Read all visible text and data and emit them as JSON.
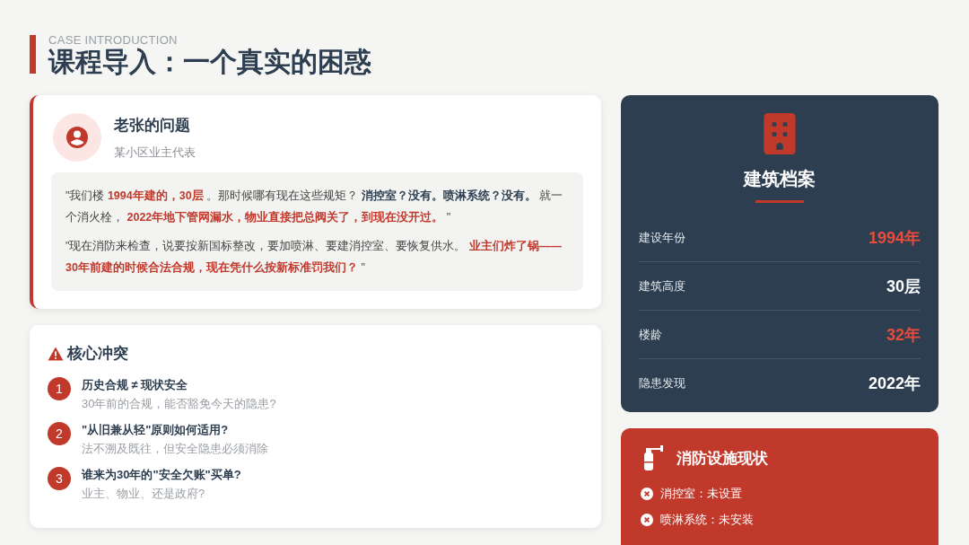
{
  "header": {
    "eyebrow": "CASE INTRODUCTION",
    "title": "课程导入：一个真实的困惑"
  },
  "case": {
    "name": "老张的问题",
    "role": "某小区业主代表",
    "quotes": [
      [
        {
          "text": "\"我们楼 ",
          "kind": "plain"
        },
        {
          "text": "1994年建的，30层",
          "kind": "red"
        },
        {
          "text": " 。那时候哪有现在这些规矩？ ",
          "kind": "plain"
        },
        {
          "text": "消控室？没有。喷淋系统？没有。",
          "kind": "strong"
        },
        {
          "text": " 就一个消火栓， ",
          "kind": "plain"
        },
        {
          "text": "2022年地下管网漏水，物业直接把总阀关了，到现在没开过。",
          "kind": "red"
        },
        {
          "text": " \"",
          "kind": "plain"
        }
      ],
      [
        {
          "text": "\"现在消防来检查，说要按新国标整改，要加喷淋、要建消控室、要恢复供水。 ",
          "kind": "plain"
        },
        {
          "text": "业主们炸了锅——30年前建的时候合法合规，现在凭什么按新标准罚我们？",
          "kind": "red"
        },
        {
          "text": " \"",
          "kind": "plain"
        }
      ]
    ]
  },
  "conflict": {
    "title": "核心冲突",
    "items": [
      {
        "number": "1",
        "title": "历史合规 ≠ 现状安全",
        "desc": "30年前的合规，能否豁免今天的隐患?"
      },
      {
        "number": "2",
        "title": "\"从旧兼从轻\"原则如何适用?",
        "desc": "法不溯及既往，但安全隐患必须消除"
      },
      {
        "number": "3",
        "title": "谁来为30年的\"安全欠账\"买单?",
        "desc": "业主、物业、还是政府?"
      }
    ]
  },
  "building": {
    "title": "建筑档案",
    "rows": [
      {
        "label": "建设年份",
        "value": "1994年",
        "highlight": true
      },
      {
        "label": "建筑高度",
        "value": "30层",
        "highlight": false
      },
      {
        "label": "楼龄",
        "value": "32年",
        "highlight": true
      },
      {
        "label": "隐患发现",
        "value": "2022年",
        "highlight": false
      }
    ]
  },
  "facilities": {
    "title": "消防设施现状",
    "items": [
      "消控室：未设置",
      "喷淋系统：未安装"
    ]
  }
}
